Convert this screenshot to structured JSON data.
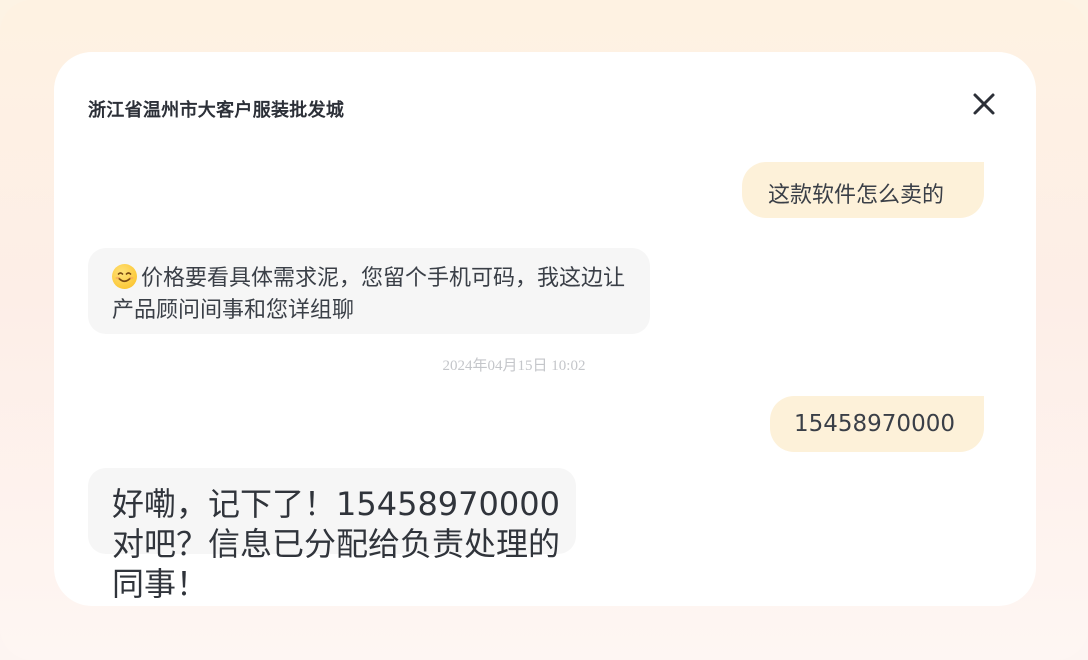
{
  "chat": {
    "title": "浙江省温州市大客户服装批发城",
    "close_icon": "close-icon",
    "timestamp": "2024年04月15日  10:02",
    "messages": [
      {
        "sender": "user",
        "text": "这款软件怎么卖的"
      },
      {
        "sender": "bot",
        "emoji": "smiling-face-icon",
        "text": "价格要看具体需求泥，您留个手机可码，我这边让产品顾问间事和您详组聊"
      },
      {
        "sender": "user",
        "text": "15458970000"
      },
      {
        "sender": "bot",
        "text": "好嘞，记下了！15458970000对吧？信息已分配给负责处理的同事！"
      }
    ]
  },
  "colors": {
    "user_bubble": "#fdf1d9",
    "bot_bubble": "#f6f6f6",
    "card": "#ffffff",
    "timestamp": "#c4c6ca"
  }
}
